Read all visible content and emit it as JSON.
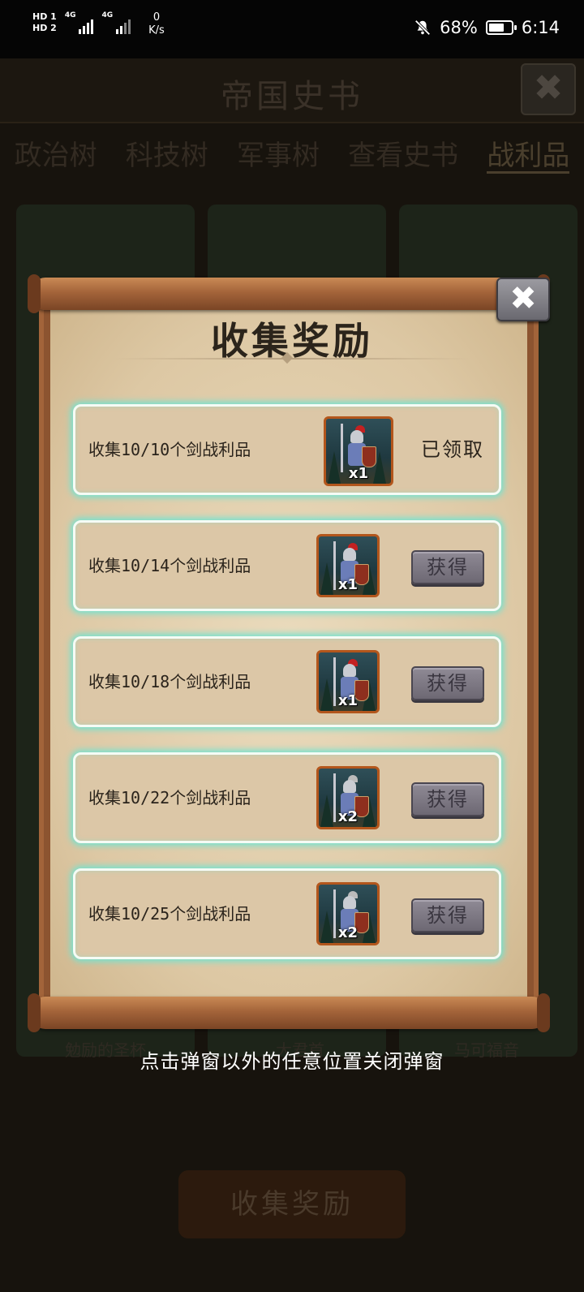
{
  "status_bar": {
    "sim1": "HD 1",
    "sim2": "HD 2",
    "net_gen1": "4G",
    "net_gen2": "4G",
    "net_speed_value": "0",
    "net_speed_unit": "K/s",
    "battery_percent": "68%",
    "battery_level": 0.68,
    "time": "6:14",
    "icons": [
      "signal-icon",
      "mute-bell-icon",
      "battery-icon"
    ]
  },
  "background_screen": {
    "title": "帝国史书",
    "close_symbol": "✖",
    "tabs": [
      "政治树",
      "科技树",
      "军事树",
      "查看史书",
      "战利品"
    ],
    "active_tab": "战利品",
    "card_labels": [
      "勉励的圣杯",
      "大君首",
      "马可福音"
    ],
    "bottom_button": "收集奖励"
  },
  "popup": {
    "title": "收集奖励",
    "close_symbol": "✖",
    "rows": [
      {
        "label": "收集10/10个剑战利品",
        "qty": "x1",
        "status": "已领取",
        "claimed": true
      },
      {
        "label": "收集10/14个剑战利品",
        "qty": "x1",
        "button": "获得",
        "claimed": false
      },
      {
        "label": "收集10/18个剑战利品",
        "qty": "x1",
        "button": "获得",
        "claimed": false
      },
      {
        "label": "收集10/22个剑战利品",
        "qty": "x2",
        "button": "获得",
        "claimed": false
      },
      {
        "label": "收集10/25个剑战利品",
        "qty": "x2",
        "button": "获得",
        "claimed": false
      }
    ],
    "dismiss_hint": "点击弹窗以外的任意位置关闭弹窗"
  },
  "colors": {
    "row_glow": "#74e2d0",
    "icon_border": "#b3561c",
    "paper": "#eadbbd",
    "scroll_wood": "#a4643a"
  }
}
